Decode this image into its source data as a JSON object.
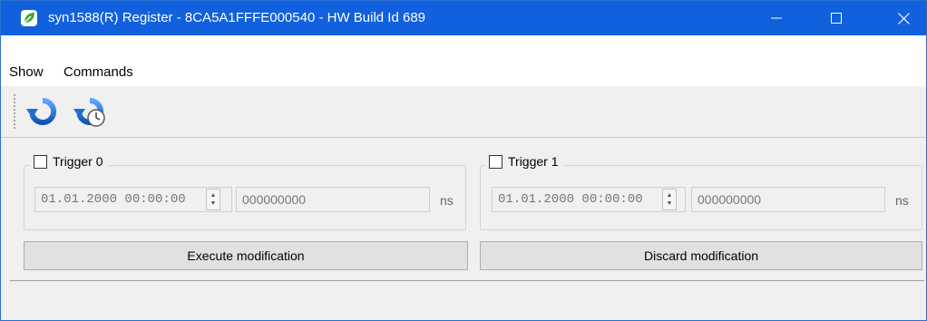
{
  "window": {
    "title": "syn1588(R) Register - 8CA5A1FFFE000540 - HW Build Id 689",
    "minimize_glyph": "─",
    "maximize_glyph": "☐",
    "close_glyph": "✕"
  },
  "menu": {
    "items": [
      {
        "label": "Show"
      },
      {
        "label": "Commands"
      }
    ]
  },
  "toolbar": {
    "buttons": [
      {
        "icon": "refresh-icon"
      },
      {
        "icon": "refresh-timer-icon"
      }
    ]
  },
  "triggers": [
    {
      "label": "Trigger 0",
      "checked": false,
      "datetime": "01.01.2000 00:00:00",
      "nanoseconds": "000000000",
      "unit": "ns"
    },
    {
      "label": "Trigger 1",
      "checked": false,
      "datetime": "01.01.2000 00:00:00",
      "nanoseconds": "000000000",
      "unit": "ns"
    }
  ],
  "actions": {
    "execute_label": "Execute modification",
    "discard_label": "Discard modification"
  },
  "colors": {
    "titlebar": "#1160de",
    "accent_blue": "#1b6fd1",
    "app_icon_green": "#3ca83c"
  }
}
